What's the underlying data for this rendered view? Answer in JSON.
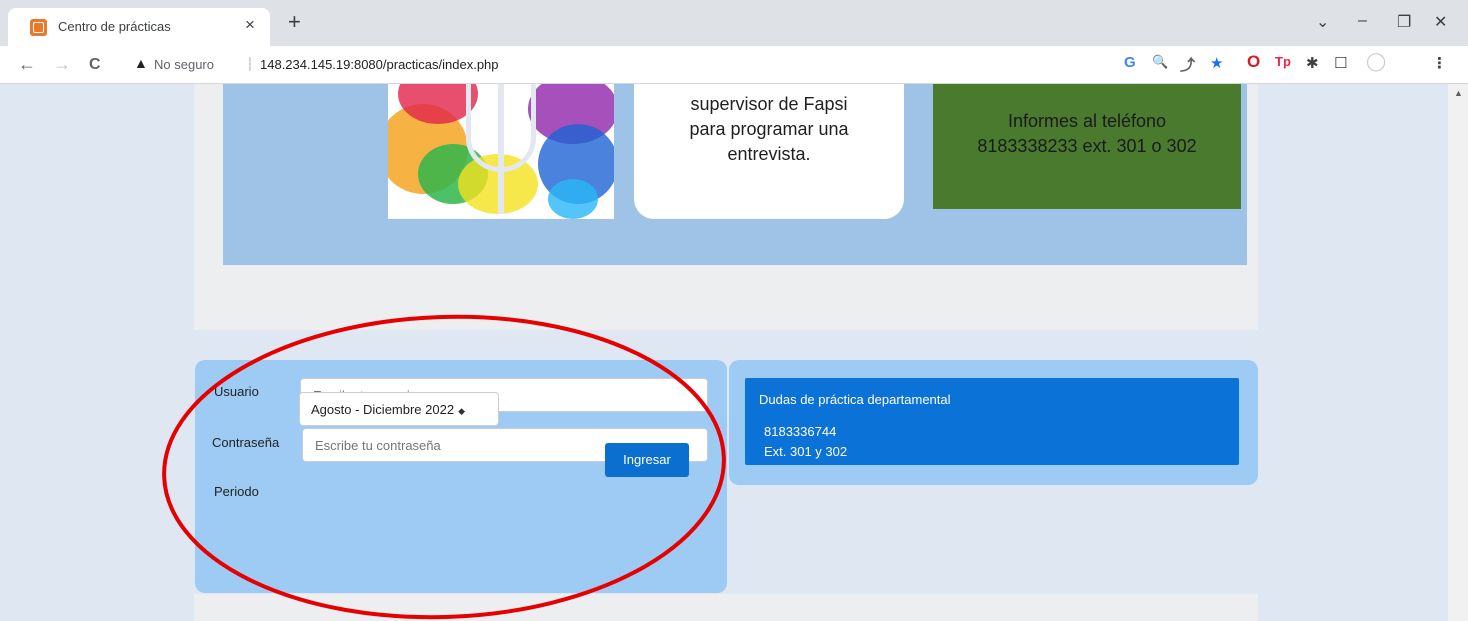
{
  "browser": {
    "tab_title": "Centro de prácticas",
    "tab_close": "×",
    "new_tab": "+",
    "window_controls": {
      "dropdown": "⌄",
      "minimize": "–",
      "maximize": "❐",
      "close": "✕"
    },
    "security_label": "No seguro",
    "url_separator": "|",
    "url": "148.234.145.19:8080/practicas/index.php",
    "nav": {
      "back": "←",
      "forward": "→",
      "reload": "C"
    },
    "toolbar_icons": [
      "G",
      "🔍",
      "⤴",
      "★",
      "O",
      "Tp",
      "✱",
      "☐",
      "◯",
      "⋮"
    ],
    "colors": {
      "tab_strip": "#dee1e6",
      "accent_star": "#1a73e8",
      "opera_red": "#d81b24"
    }
  },
  "banner": {
    "info_lines": [
      "supervisor de Fapsi",
      "para programar una",
      "entrevista."
    ],
    "contact_lines": [
      "Informes al teléfono",
      "8183338233 ext. 301 o 302"
    ],
    "colors": {
      "banner_bg": "#9ec3e6",
      "contact_bg": "#4a7a2e"
    }
  },
  "login": {
    "user_label": "Usuario",
    "user_placeholder": "Escribe tu usuario",
    "password_label": "Contraseña",
    "password_placeholder": "Escribe tu contraseña",
    "period_label": "Periodo",
    "period_value": "Agosto - Diciembre 2022",
    "submit_label": "Ingresar",
    "colors": {
      "panel_bg": "#9ecbf3",
      "button_bg": "#0b6fcf"
    }
  },
  "help": {
    "title": "Dudas de práctica departamental",
    "phone": "8183336744",
    "extension": "Ext. 301 y 302",
    "colors": {
      "box_bg": "#0b72d8"
    }
  },
  "annotation": {
    "shape": "ellipse",
    "color": "#e60000"
  }
}
